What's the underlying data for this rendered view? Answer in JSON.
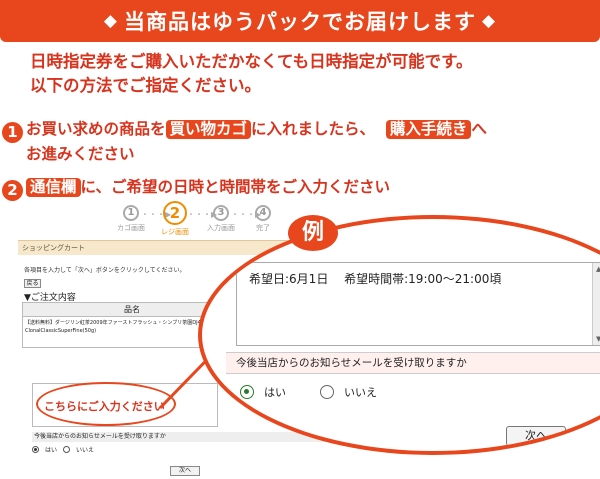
{
  "banner": {
    "left_symbol": "◆",
    "title": "当商品はゆうパックでお届けします",
    "right_symbol": "◆"
  },
  "intro": {
    "line1": "日時指定券をご購入いただかなくても日時指定が可能です。",
    "line2": "以下の方法でご指定ください。"
  },
  "step1": {
    "number": "1",
    "text_a": "お買い求めの商品を",
    "tag_a": "買い物カゴ",
    "text_b": "に入れましたら、",
    "tag_b": "購入手続き",
    "text_c": "へ",
    "text_d": "お進みください"
  },
  "step2": {
    "number": "2",
    "tag": "通信欄",
    "text": "に、ご希望の日時と時間帯をご入力ください"
  },
  "progress": {
    "steps": [
      {
        "num": "1",
        "label": "カゴ画面"
      },
      {
        "num": "2",
        "label": "レジ画面"
      },
      {
        "num": "3",
        "label": "入力画面"
      },
      {
        "num": "4",
        "label": "完了"
      }
    ],
    "arrow": "・・・▶"
  },
  "cart": {
    "header": "ショッピングカート",
    "instruction": "各項目を入力して「次へ」ボタンをクリックしてください。",
    "back_label": "戻る",
    "order_heading": "▼ご注文内容",
    "column_header": "品名",
    "item_line1": "【送料無料】ダージリン紅茶2009年ファーストフラッシュ・シンブリ茶園DJ4",
    "item_line2": "ClonalClassicSuperFine(50g)",
    "input_hint": "こちらにご入力ください",
    "mail_label": "今後当店からのお知らせメールを受け取りますか",
    "yes": "はい",
    "no": "いいえ",
    "next": "次へ"
  },
  "zoom": {
    "example_label": "例",
    "comment": "希望日:6月1日　 希望時間帯:19:00～21:00頃",
    "mail_label": "今後当店からのお知らせメールを受け取りますか",
    "yes": "はい",
    "no": "いいえ",
    "next": "次へ"
  },
  "colors": {
    "accent": "#e8461c",
    "step_active": "#f08c00"
  }
}
